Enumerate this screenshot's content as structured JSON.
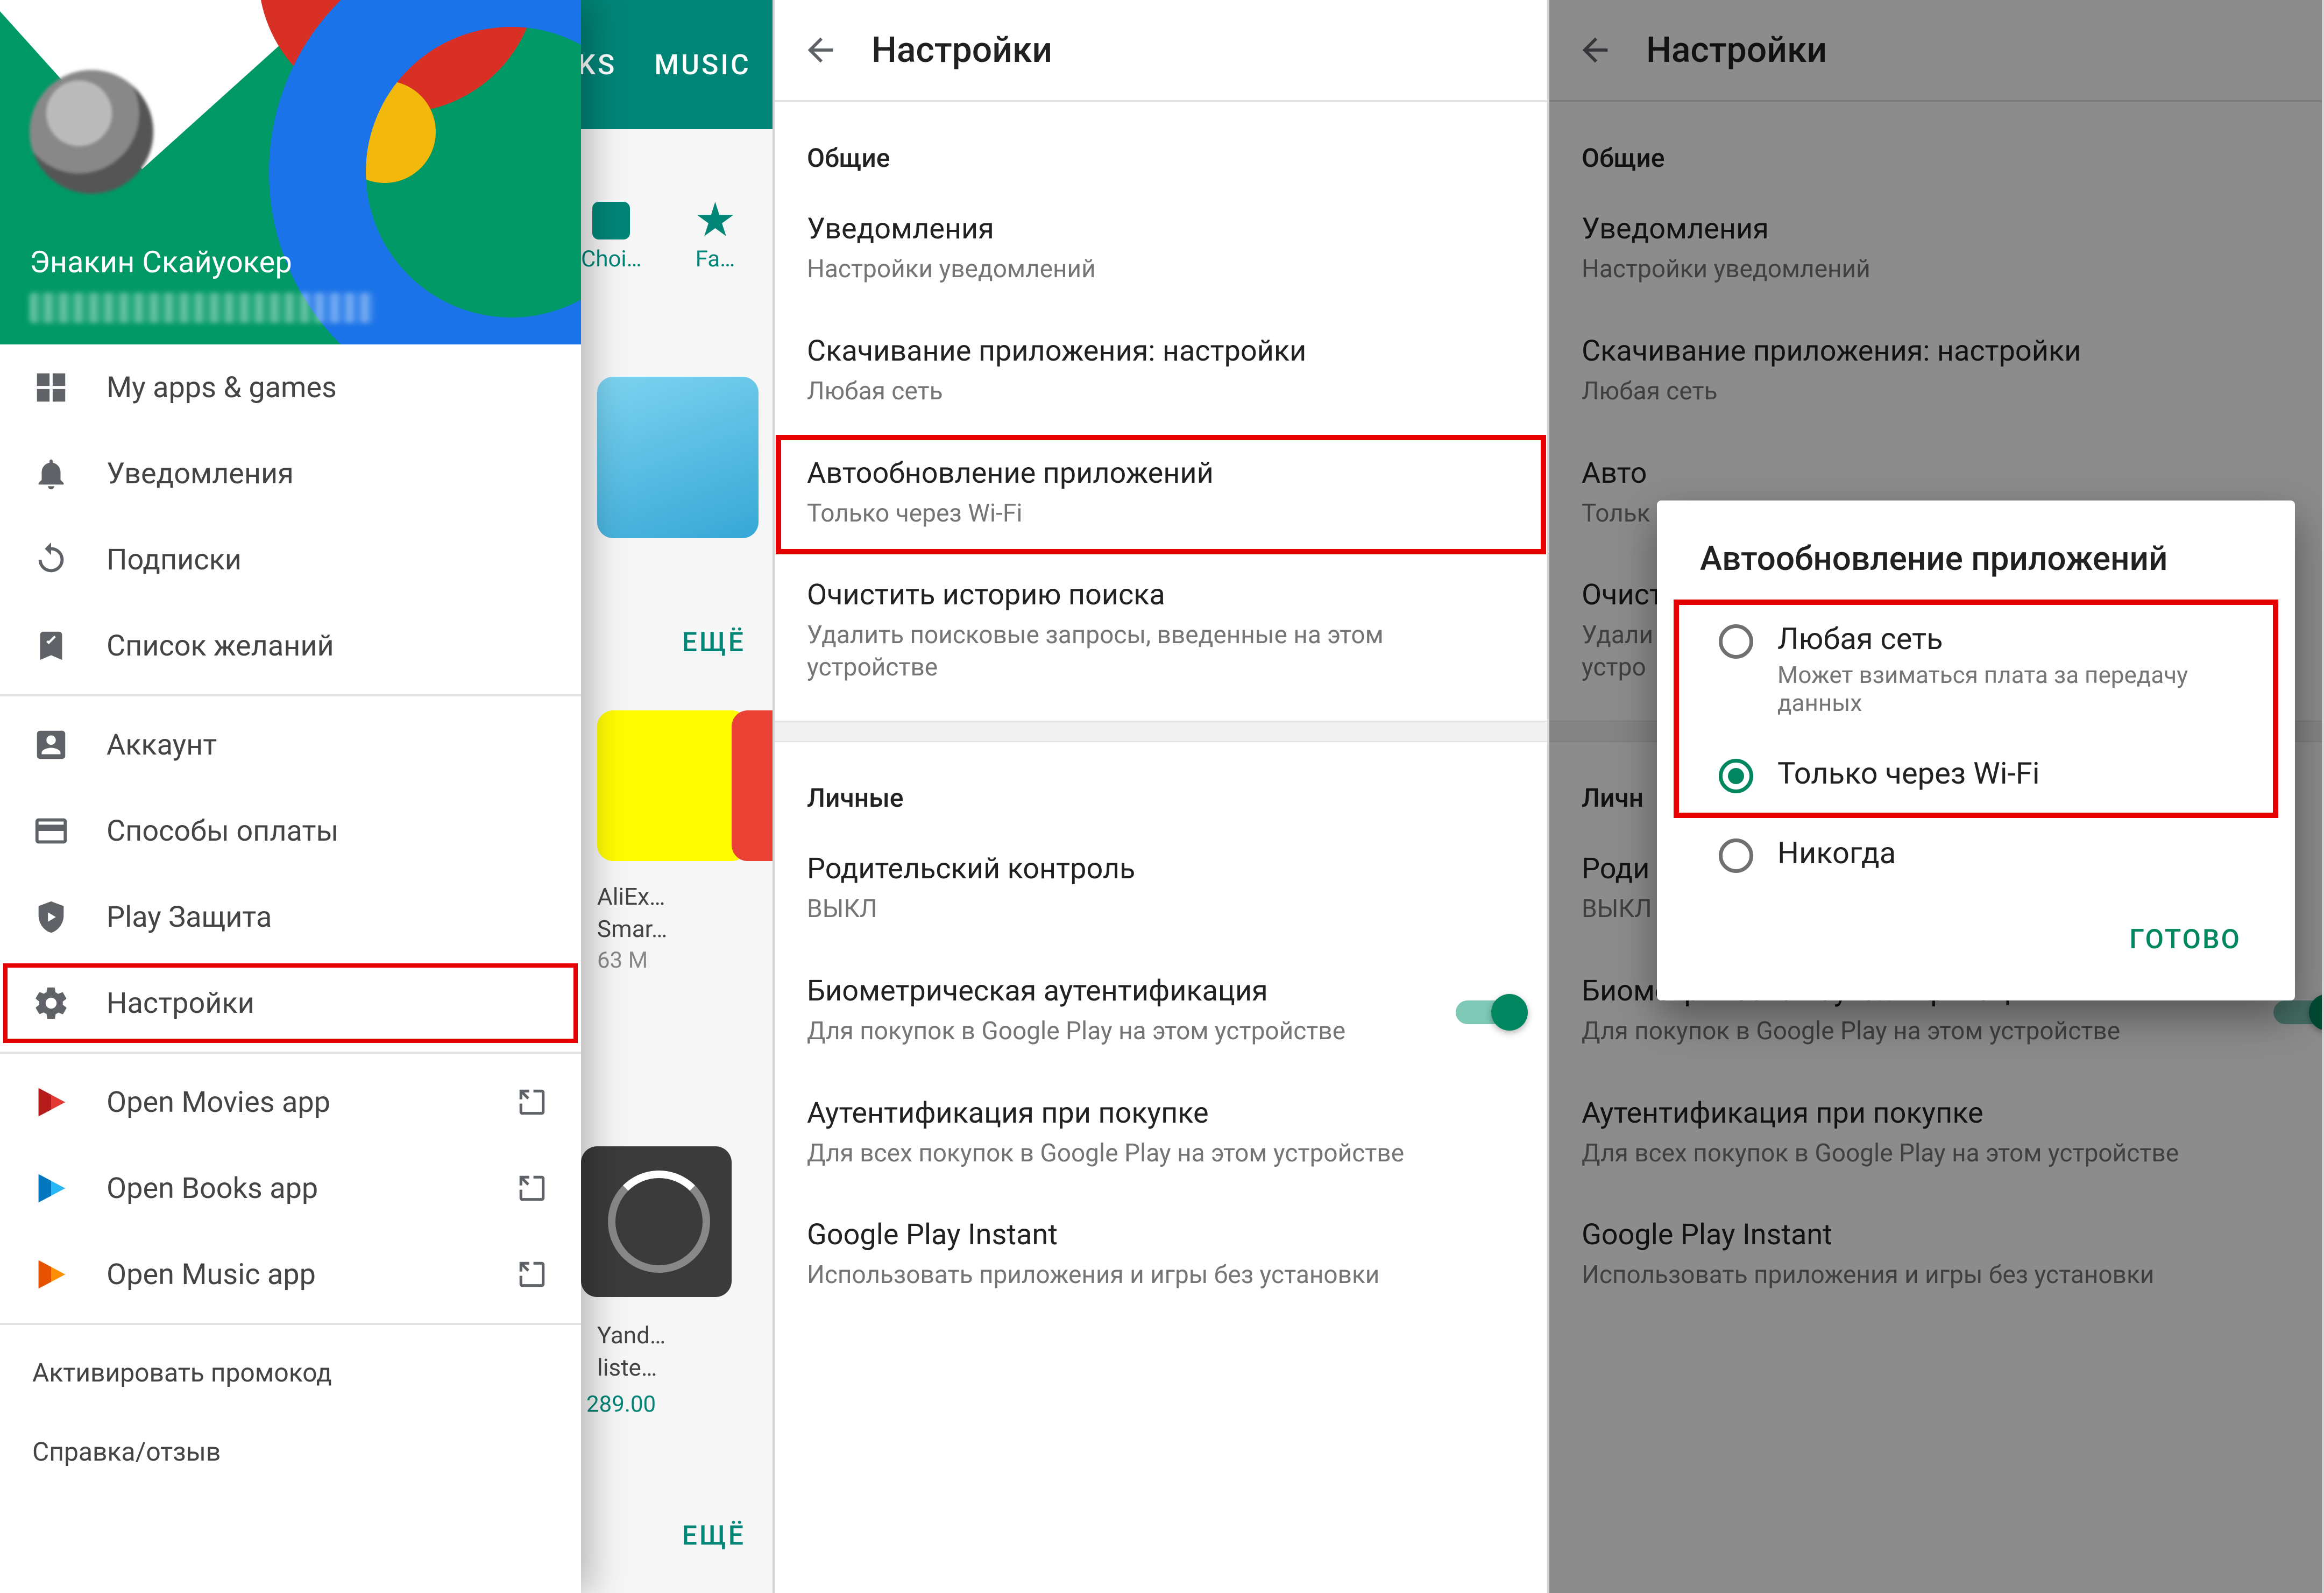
{
  "panel1": {
    "store": {
      "tab_right": "MUSIC",
      "tab_mid_suffix": "KS",
      "chip_choice": "Choi…",
      "chip_family": "Fa…",
      "more": "ЕЩЁ",
      "app1_name": "AliEx…",
      "app1_line2": "Smar…",
      "app1_meta": "63 M",
      "app2_name": "Yand…",
      "app2_line2": "liste…",
      "app2_price": "289.00"
    },
    "user": {
      "name": "Энакин Скайуокер"
    },
    "menu": {
      "apps": "My apps & games",
      "notifications": "Уведомления",
      "subscriptions": "Подписки",
      "wishlist": "Список желаний",
      "account": "Аккаунт",
      "payments": "Способы оплаты",
      "protect": "Play Защита",
      "settings": "Настройки",
      "open_movies": "Open Movies app",
      "open_books": "Open Books app",
      "open_music": "Open Music app",
      "promo": "Активировать промокод",
      "help": "Справка/отзыв"
    }
  },
  "settings": {
    "title": "Настройки",
    "sections": {
      "general": "Общие",
      "personal": "Личные"
    },
    "items": {
      "notif": {
        "t": "Уведомления",
        "s": "Настройки уведомлений"
      },
      "download": {
        "t": "Скачивание приложения: настройки",
        "s": "Любая сеть"
      },
      "autoupdate": {
        "t": "Автообновление приложений",
        "s": "Только через Wi-Fi"
      },
      "clear": {
        "t": "Очистить историю поиска",
        "s": "Удалить поисковые запросы, введенные на этом устройстве"
      },
      "parental": {
        "t": "Родительский контроль",
        "s": "ВЫКЛ"
      },
      "biometric": {
        "t": "Биометрическая аутентификация",
        "s": "Для покупок в Google Play на этом устройстве"
      },
      "purchase_auth": {
        "t": "Аутентификация при покупке",
        "s": "Для всех покупок в Google Play на этом устройстве"
      },
      "instant": {
        "t": "Google Play Instant",
        "s": "Использовать приложения и игры без установки"
      }
    }
  },
  "panel3": {
    "truncated": {
      "autoupdate_t": "Авто",
      "autoupdate_s": "Тольк",
      "clear_t": "Очист",
      "clear_s": "Удали",
      "clear_s2": "устро",
      "personal": "Личн",
      "parental_t": "Роди",
      "parental_s": "ВЫКЛ"
    },
    "dialog": {
      "title": "Автообновление приложений",
      "opt_any": {
        "t": "Любая сеть",
        "s": "Может взиматься плата за передачу данных"
      },
      "opt_wifi": {
        "t": "Только через Wi-Fi"
      },
      "opt_never": {
        "t": "Никогда"
      },
      "done": "ГОТОВО"
    }
  }
}
